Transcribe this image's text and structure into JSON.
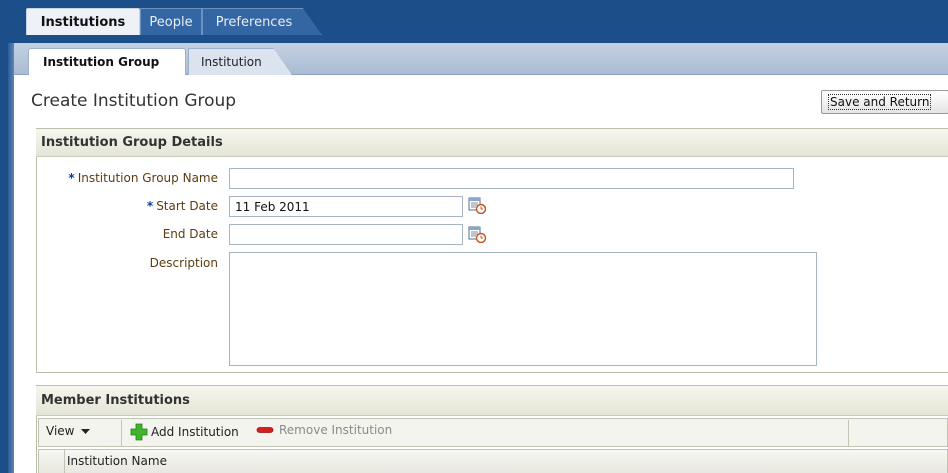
{
  "top_tabs": {
    "institutions": "Institutions",
    "people": "People",
    "preferences": "Preferences"
  },
  "sub_tabs": {
    "institution_group": "Institution Group",
    "institution": "Institution"
  },
  "page": {
    "title": "Create Institution Group",
    "save_and_return": "Save and Return"
  },
  "details": {
    "header": "Institution Group Details",
    "required_marker": "*",
    "group_name_label": "Institution Group Name",
    "group_name_value": "",
    "start_date_label": "Start Date",
    "start_date_value": "11 Feb 2011",
    "end_date_label": "End Date",
    "end_date_value": "",
    "description_label": "Description",
    "description_value": ""
  },
  "members": {
    "header": "Member Institutions",
    "view_menu": "View",
    "add_institution": "Add Institution",
    "remove_institution": "Remove Institution",
    "column_institution_name": "Institution Name"
  },
  "icons": {
    "calendar": "calendar-clock-icon",
    "add": "green-plus-icon",
    "remove": "red-minus-icon",
    "dropdown": "chevron-down-icon"
  },
  "colors": {
    "frame_blue": "#1c4e8a",
    "label_brown": "#5c3d12",
    "required_blue": "#0040a0",
    "panel_header": "#e4e5d7"
  }
}
